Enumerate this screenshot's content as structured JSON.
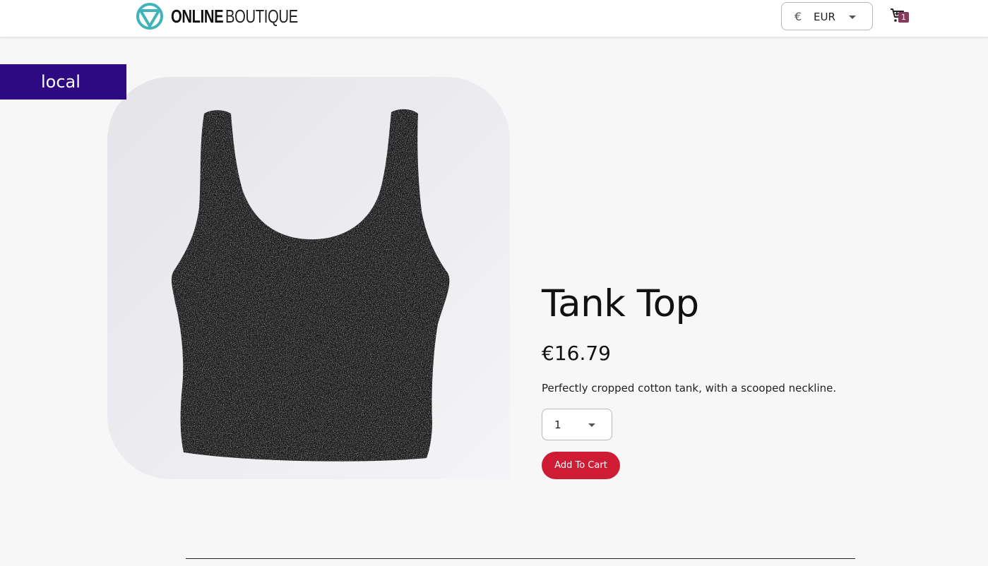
{
  "header": {
    "logo_bold": "ONLINE",
    "logo_light": "BOUTIQUE",
    "currency_symbol": "€",
    "currency_code": "EUR",
    "cart_count": "1"
  },
  "env_badge": "local",
  "product": {
    "name": "Tank Top",
    "price": "€16.79",
    "description": "Perfectly cropped cotton tank, with a scooped neckline.",
    "quantity": "1",
    "add_to_cart_label": "Add To Cart"
  },
  "colors": {
    "brand_teal": "#41b3ba",
    "badge_purple": "#2d0a82",
    "cart_count_bg": "#853b5c",
    "add_button": "#cf1c35"
  },
  "icons": {
    "logo": "logo-icon",
    "cart": "cart-icon",
    "dropdown": "chevron-down-icon"
  }
}
